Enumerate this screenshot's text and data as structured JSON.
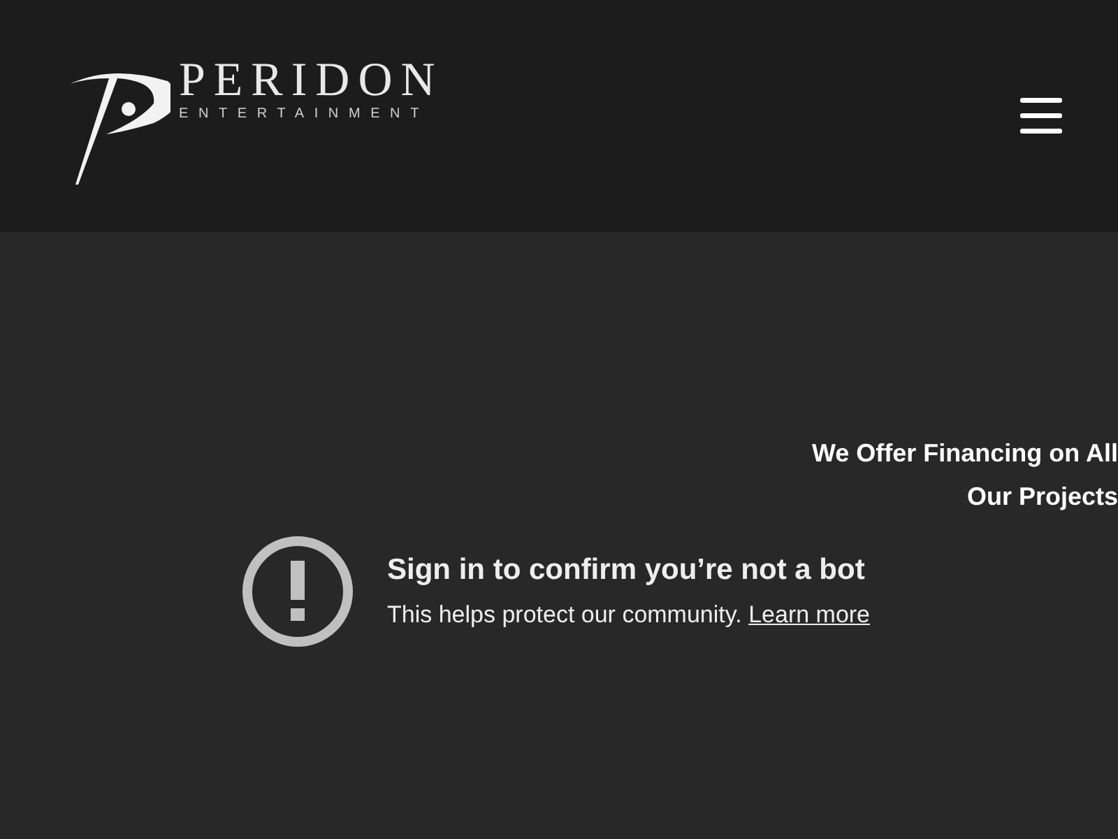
{
  "header": {
    "logo": {
      "name": "PERIDON",
      "tagline": "ENTERTAINMENT"
    }
  },
  "banner": {
    "lines": [
      "We Offer Financing on All",
      "Our Projects"
    ]
  },
  "notice": {
    "title": "Sign in to confirm you’re not a bot",
    "message": "This helps protect our community.",
    "link": "Learn more"
  }
}
